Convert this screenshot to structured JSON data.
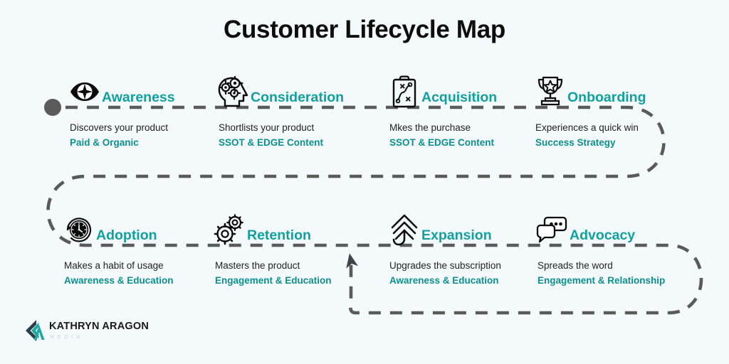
{
  "title": "Customer Lifecycle Map",
  "colors": {
    "background": "#f4f9fc",
    "accent_teal": "#11a0a0",
    "tag_teal": "#0d8f8f",
    "path_gray": "#5a5a5a",
    "title_black": "#0d0d0d",
    "start_dot": "#5a5a5a"
  },
  "stages": [
    {
      "id": "awareness",
      "label": "Awareness",
      "icon": "eye-icon",
      "description": "Discovers your product",
      "tag": "Paid & Organic"
    },
    {
      "id": "consideration",
      "label": "Consideration",
      "icon": "head-gears-icon",
      "description": "Shortlists your product",
      "tag": "SSOT & EDGE Content"
    },
    {
      "id": "acquisition",
      "label": "Acquisition",
      "icon": "clipboard-strategy-icon",
      "description": "Mkes the purchase",
      "tag": "SSOT & EDGE Content"
    },
    {
      "id": "onboarding",
      "label": "Onboarding",
      "icon": "trophy-icon",
      "description": "Experiences a quick win",
      "tag": "Success Strategy"
    },
    {
      "id": "adoption",
      "label": "Adoption",
      "icon": "clock-icon",
      "description": "Makes a habit of usage",
      "tag": "Awareness & Education"
    },
    {
      "id": "retention",
      "label": "Retention",
      "icon": "gears-icon",
      "description": "Masters the product",
      "tag": "Engagement & Education"
    },
    {
      "id": "expansion",
      "label": "Expansion",
      "icon": "up-arrow-icon",
      "description": "Upgrades the subscription",
      "tag": "Awareness & Education"
    },
    {
      "id": "advocacy",
      "label": "Advocacy",
      "icon": "speech-bubbles-icon",
      "description": "Spreads the word",
      "tag": "Engagement & Relationship"
    }
  ],
  "logo": {
    "name": "KATHRYN ARAGON",
    "subtitle": "MEDIA",
    "mark": "chevron-a-logo-icon"
  }
}
